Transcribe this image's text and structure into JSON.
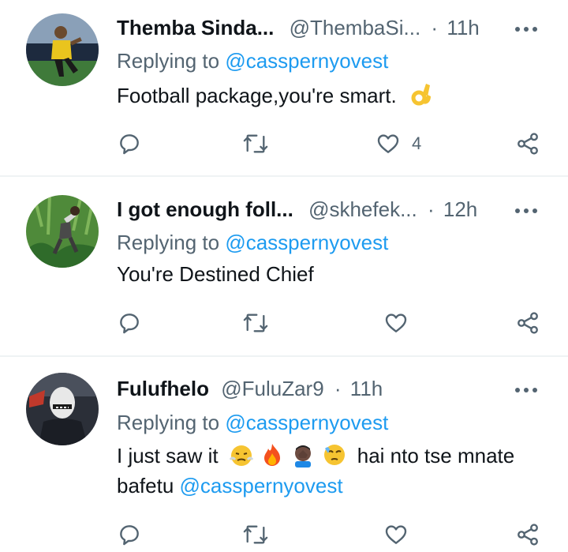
{
  "tweets": [
    {
      "name": "Themba Sinda...",
      "handle": "@ThembaSi...",
      "dot": "·",
      "time": "11h",
      "replying_prefix": "Replying to ",
      "replying_to": "@casspernyovest",
      "text": "Football package,you're smart.",
      "emojis": [
        "ok-hand"
      ],
      "likes": "4"
    },
    {
      "name": "I got enough foll...",
      "handle": "@skhefek...",
      "dot": "·",
      "time": "12h",
      "replying_prefix": "Replying to ",
      "replying_to": "@casspernyovest",
      "text": "You're Destined Chief",
      "likes": ""
    },
    {
      "name": "Fulufhelo",
      "handle": "@FuluZar9",
      "dot": "·",
      "time": "11h",
      "replying_prefix": "Replying to ",
      "replying_to": "@casspernyovest",
      "text_part1": "I just saw it",
      "emojis": [
        "triumph-face",
        "fire",
        "facepalm-man",
        "sad-relieved-face"
      ],
      "text_part2": "hai nto tse mnate",
      "text_line2": "bafetu",
      "mention_inline": "@casspernyovest",
      "likes": ""
    }
  ],
  "icons": {
    "reply": "speech-bubble-icon",
    "retweet": "retweet-icon",
    "like": "heart-icon",
    "share": "share-icon",
    "more": "more-dots-icon"
  },
  "colors": {
    "accent": "#1d9bf0",
    "secondary_text": "#536471",
    "primary_text": "#0f1419",
    "divider": "#eff3f4"
  }
}
